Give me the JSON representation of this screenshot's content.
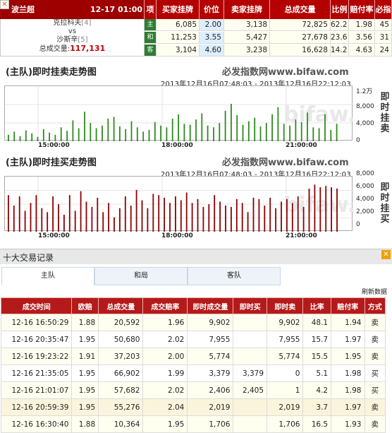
{
  "match": {
    "league": "波兰超",
    "time": "12-17 01:00",
    "home_team": "克拉科夫",
    "home_rank": "[4]",
    "vs": "vs",
    "away_team": "沙斯辛",
    "away_rank": "[5]",
    "total_label": "总成交量:",
    "total_value": "117,131"
  },
  "odds_headers": [
    "项",
    "买家挂牌",
    "价位",
    "卖家挂牌",
    "总成交量",
    "比例",
    "赔付率",
    "必指"
  ],
  "odds_rows": [
    {
      "label": "主",
      "buy": "6,085",
      "price": "2.00",
      "sell": "3,138",
      "total": "72,825",
      "ratio": "62.2",
      "payout": "1.98",
      "index": "45"
    },
    {
      "label": "和",
      "buy": "11,253",
      "price": "3.55",
      "sell": "5,427",
      "total": "27,678",
      "ratio": "23.6",
      "payout": "3.56",
      "index": "31"
    },
    {
      "label": "客",
      "buy": "3,104",
      "price": "4.60",
      "sell": "3,238",
      "total": "16,628",
      "ratio": "14.2",
      "payout": "4.63",
      "index": "24"
    }
  ],
  "charts": [
    {
      "title": "(主队)即时挂卖走势图",
      "brand": "必发指数网www.bifaw.com",
      "range": "2013年12月16日07:48:03 - 2013年12月16日22:12:03",
      "y_labels": [
        "1.2万",
        "8,000",
        "4,000",
        "0"
      ],
      "x_labels": [
        "15:00:00",
        "18:00:00",
        "21:00:00"
      ],
      "side_title": "即时挂卖",
      "watermark": "bifaw.com"
    },
    {
      "title": "(主队)即时挂买走势图",
      "brand": "必发指数网www.bifaw.com",
      "range": "2013年12月16日07:48:03 - 2013年12月16日22:12:03",
      "y_labels": [
        "8,000",
        "6,000",
        "4,000",
        "2,000",
        "0"
      ],
      "x_labels": [
        "15:00:00",
        "18:00:00",
        "21:00:00"
      ],
      "side_title": "即时挂买",
      "watermark": "bifaw.com"
    }
  ],
  "chart_data": [
    {
      "type": "bar",
      "title": "(主队)即时挂卖走势图",
      "xlabel": "",
      "ylabel": "即时挂卖",
      "ylim": [
        0,
        12000
      ],
      "x": [
        "15:00:00",
        "18:00:00",
        "21:00:00"
      ],
      "color": "#2d8a1e",
      "values_sample": [
        1500,
        2200,
        1200,
        2500,
        1800,
        1000,
        2800,
        2000,
        1500,
        3200,
        2400,
        4800,
        3000,
        6800,
        4200,
        3000,
        3600,
        5200,
        5600,
        3400,
        2800,
        4600,
        3200,
        2200,
        2600,
        4400,
        3600,
        3200,
        5200,
        6200,
        4000,
        3800,
        5000,
        6400,
        3600,
        3200,
        4200,
        7000,
        8600,
        6000,
        3800,
        4600,
        5400,
        3400,
        4200,
        6200,
        7800,
        4000,
        3600,
        5000,
        4400,
        6600,
        3200,
        3000,
        6200,
        2600,
        4000
      ]
    },
    {
      "type": "bar",
      "title": "(主队)即时挂买走势图",
      "xlabel": "",
      "ylabel": "即时挂买",
      "ylim": [
        0,
        8000
      ],
      "x": [
        "15:00:00",
        "18:00:00",
        "21:00:00"
      ],
      "color": "#8b0000",
      "values_sample": [
        5600,
        4000,
        5400,
        3200,
        4400,
        5600,
        3600,
        3000,
        5400,
        4200,
        2600,
        5600,
        3200,
        6200,
        4600,
        3800,
        5200,
        3000,
        4400,
        2200,
        3600,
        5400,
        4000,
        6400,
        4800,
        3600,
        5800,
        5600,
        5200,
        4400,
        5400,
        4800,
        6000,
        4400,
        5000,
        3800,
        4200,
        5600,
        4600,
        4000,
        3800,
        5000,
        4400,
        3000,
        5200,
        5000,
        4000,
        5200,
        3600,
        4600,
        5000,
        4400,
        5400,
        3800,
        6600,
        7200,
        6800,
        7000,
        6800,
        6600
      ]
    }
  ],
  "records": {
    "header_title": "十大交易记录",
    "tabs": [
      "主队",
      "和局",
      "客队"
    ],
    "refresh": "刷新数据",
    "columns": [
      "成交时间",
      "欧赔",
      "总成交量",
      "成交赔率",
      "即时成交量",
      "即时买",
      "即时卖",
      "比率",
      "赔付率",
      "方式"
    ],
    "rows": [
      {
        "time": "12-16 16:50:29",
        "euro": "1.88",
        "total": "20,592",
        "odds": "1.96",
        "instant": "9,902",
        "buy": "",
        "sell": "9,902",
        "ratio": "48.1",
        "payout": "1.94",
        "mode": "卖",
        "kind": "sell"
      },
      {
        "time": "12-16 20:35:47",
        "euro": "1.95",
        "total": "50,680",
        "odds": "2.02",
        "instant": "7,955",
        "buy": "",
        "sell": "7,955",
        "ratio": "15.7",
        "payout": "1.97",
        "mode": "卖",
        "kind": "sell"
      },
      {
        "time": "12-16 19:23:22",
        "euro": "1.91",
        "total": "37,203",
        "odds": "2.00",
        "instant": "5,774",
        "buy": "",
        "sell": "5,774",
        "ratio": "15.5",
        "payout": "1.95",
        "mode": "卖",
        "kind": "sell"
      },
      {
        "time": "12-16 21:35:05",
        "euro": "1.95",
        "total": "66,902",
        "odds": "1.99",
        "instant": "3,379",
        "buy": "3,379",
        "sell": "0",
        "ratio": "5.1",
        "payout": "1.98",
        "mode": "买",
        "kind": "buy"
      },
      {
        "time": "12-16 21:01:07",
        "euro": "1.95",
        "total": "57,682",
        "odds": "2.02",
        "instant": "2,406",
        "buy": "2,405",
        "sell": "1",
        "ratio": "4.2",
        "payout": "1.98",
        "mode": "买",
        "kind": "buy"
      },
      {
        "time": "12-16 20:59:39",
        "euro": "1.95",
        "total": "55,276",
        "odds": "2.04",
        "instant": "2,019",
        "buy": "",
        "sell": "2,019",
        "ratio": "3.7",
        "payout": "1.97",
        "mode": "卖",
        "kind": "sell"
      },
      {
        "time": "12-16 16:30:40",
        "euro": "1.88",
        "total": "10,364",
        "odds": "1.95",
        "instant": "1,706",
        "buy": "",
        "sell": "1,706",
        "ratio": "16.5",
        "payout": "1.93",
        "mode": "卖",
        "kind": "sell"
      }
    ]
  }
}
